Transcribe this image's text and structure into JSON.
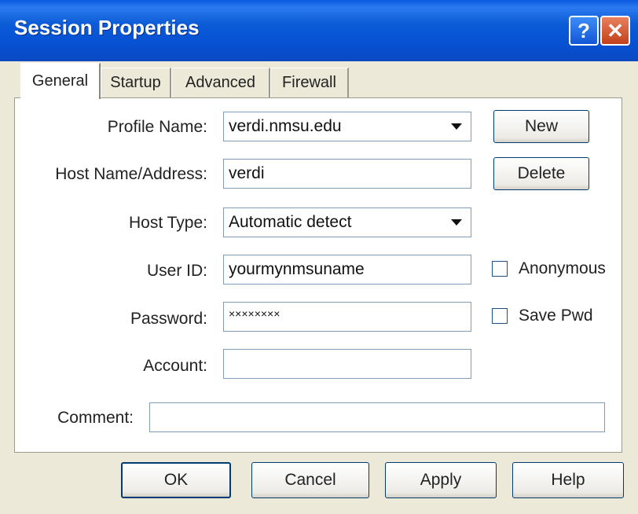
{
  "window": {
    "title": "Session Properties"
  },
  "titlebar_buttons": {
    "help": "?",
    "close": "✕"
  },
  "tabs": [
    {
      "label": "General",
      "active": true
    },
    {
      "label": "Startup",
      "active": false
    },
    {
      "label": "Advanced",
      "active": false
    },
    {
      "label": "Firewall",
      "active": false
    }
  ],
  "form": {
    "profile_name": {
      "label": "Profile Name:",
      "value": "verdi.nmsu.edu"
    },
    "host_name": {
      "label": "Host Name/Address:",
      "value": "verdi"
    },
    "host_type": {
      "label": "Host Type:",
      "value": "Automatic detect"
    },
    "user_id": {
      "label": "User ID:",
      "value": "yourmynmsuname"
    },
    "password": {
      "label": "Password:",
      "value": "××××××××"
    },
    "account": {
      "label": "Account:",
      "value": ""
    },
    "comment": {
      "label": "Comment:",
      "value": ""
    }
  },
  "checkboxes": {
    "anonymous": {
      "label": "Anonymous",
      "checked": false
    },
    "save_pwd": {
      "label": "Save Pwd",
      "checked": false
    }
  },
  "side_buttons": {
    "new": "New",
    "delete": "Delete"
  },
  "footer_buttons": {
    "ok": "OK",
    "cancel": "Cancel",
    "apply": "Apply",
    "help": "Help"
  }
}
